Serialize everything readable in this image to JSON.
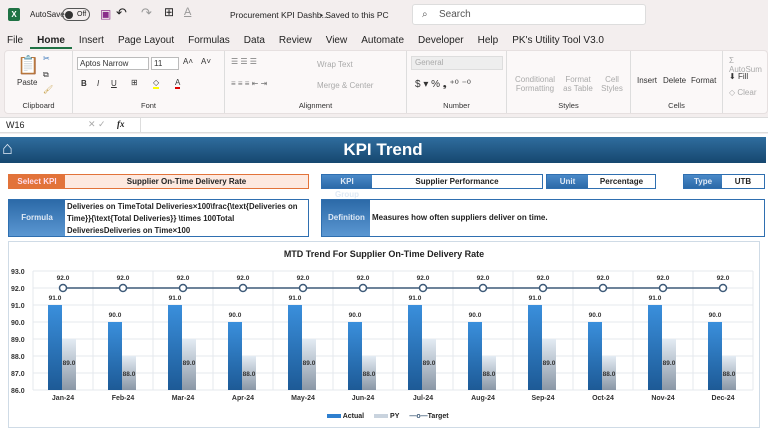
{
  "titlebar": {
    "app_icon": "excel-icon",
    "autosave_label": "AutoSave",
    "autosave_state": "Off",
    "doc_title": "Procurement KPI Dashb...",
    "save_status": "• Saved to this PC",
    "search_placeholder": "Search"
  },
  "menu": [
    "File",
    "Home",
    "Insert",
    "Page Layout",
    "Formulas",
    "Data",
    "Review",
    "View",
    "Automate",
    "Developer",
    "Help",
    "PK's Utility Tool V3.0"
  ],
  "ribbon": {
    "clipboard": {
      "paste": "Paste",
      "label": "Clipboard"
    },
    "font": {
      "name": "Aptos Narrow",
      "size": "11",
      "label": "Font"
    },
    "alignment": {
      "wrap": "Wrap Text",
      "merge": "Merge & Center",
      "label": "Alignment"
    },
    "number": {
      "format": "General",
      "label": "Number"
    },
    "styles": {
      "cond": "Conditional Formatting",
      "table": "Format as Table",
      "cell": "Cell Styles",
      "label": "Styles"
    },
    "cells": {
      "insert": "Insert",
      "delete": "Delete",
      "format": "Format",
      "label": "Cells"
    },
    "editing": {
      "autosum": "AutoSum",
      "fill": "Fill",
      "clear": "Clear"
    }
  },
  "formula_bar": {
    "cell_ref": "W16",
    "fx": "fx",
    "content": ""
  },
  "dashboard": {
    "title": "KPI Trend",
    "select_kpi_label": "Select KPI",
    "select_kpi_value": "Supplier On-Time Delivery Rate",
    "kpi_group_label": "KPI Group",
    "kpi_group_value": "Supplier Performance",
    "unit_label": "Unit",
    "unit_value": "Percentage",
    "type_label": "Type",
    "type_value": "UTB",
    "formula_label": "Formula",
    "formula_value": "Deliveries on TimeTotal Deliveries×100\\frac{\\text{Deliveries on Time}}{\\text{Total Deliveries}} \\times 100Total DeliveriesDeliveries on Time×100",
    "definition_label": "Definition",
    "definition_value": "Measures how often suppliers deliver on time."
  },
  "chart_data": {
    "type": "bar",
    "title": "MTD Trend For Supplier On-Time Delivery Rate",
    "categories": [
      "Jan-24",
      "Feb-24",
      "Mar-24",
      "Apr-24",
      "May-24",
      "Jun-24",
      "Jul-24",
      "Aug-24",
      "Sep-24",
      "Oct-24",
      "Nov-24",
      "Dec-24"
    ],
    "series": [
      {
        "name": "Actual",
        "kind": "bar",
        "values": [
          91,
          90,
          91,
          90,
          91,
          90,
          91,
          90,
          91,
          90,
          91,
          90
        ]
      },
      {
        "name": "PY",
        "kind": "bar",
        "values": [
          89,
          88,
          89,
          88,
          89,
          88,
          89,
          88,
          89,
          88,
          89,
          88
        ]
      },
      {
        "name": "Target",
        "kind": "line",
        "values": [
          92,
          92,
          92,
          92,
          92,
          92,
          92,
          92,
          92,
          92,
          92,
          92
        ]
      }
    ],
    "ylim": [
      86,
      93
    ],
    "yticks": [
      "86.0",
      "87.0",
      "88.0",
      "89.0",
      "90.0",
      "91.0",
      "92.0",
      "93.0"
    ],
    "grid": true,
    "legend": "bottom",
    "colors": {
      "actual": "#2e7fcf",
      "py": "#c9d3de",
      "target": "#3d5a78"
    }
  }
}
